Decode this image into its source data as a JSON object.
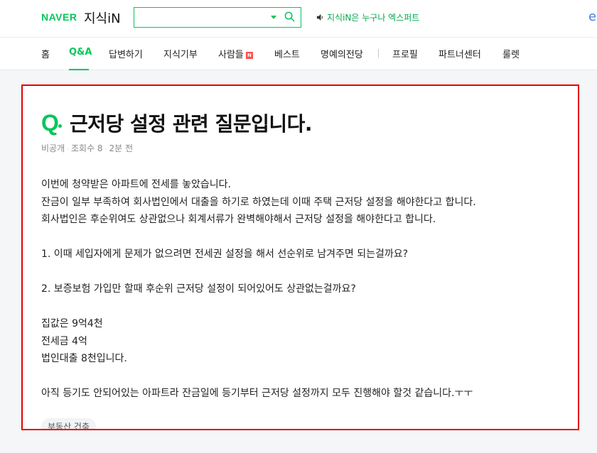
{
  "header": {
    "naver_logo": "NAVER",
    "kin_logo": "지식iN",
    "search_value": "",
    "promo_text": "지식iN은 누구나 엑스퍼트",
    "edge_char": "e"
  },
  "nav": {
    "items": [
      "홈",
      "Q&A",
      "답변하기",
      "지식기부",
      "사람들",
      "베스트",
      "명예의전당",
      "프로필",
      "파트너센터",
      "룰렛"
    ],
    "badge": "N",
    "active": "Q&A"
  },
  "question": {
    "q_mark": "Q",
    "title": "근저당 설정 관련 질문입니다.",
    "author": "비공개",
    "views": "조회수 8",
    "time": "2분 전",
    "paragraphs": [
      [
        "이번에 청약받은 아파트에 전세를 놓았습니다.",
        "잔금이 일부 부족하여 회사법인에서 대출을 하기로 하였는데 이때 주택 근저당 설정을 해야한다고 합니다.",
        "회사법인은 후순위여도 상관없으나 회계서류가 완벽해야해서 근저당 설정을 해야한다고 합니다."
      ],
      [
        "1. 이때 세입자에게 문제가 없으려면 전세권 설정을 해서 선순위로 남겨주면 되는걸까요?"
      ],
      [
        "2. 보증보험 가입만 할때 후순위 근저당 설정이 되어있어도 상관없는걸까요?"
      ],
      [
        "집값은 9억4천",
        "전세금 4억",
        "법인대출 8천입니다."
      ],
      [
        "아직 등기도 안되어있는 아파트라 잔금일에 등기부터 근저당 설정까지 모두 진행해야 할것 같습니다.ㅜㅜ"
      ]
    ],
    "tag": "부동산 건축"
  },
  "colors": {
    "brand_green": "#03c75a",
    "highlight_border": "#e60000"
  }
}
